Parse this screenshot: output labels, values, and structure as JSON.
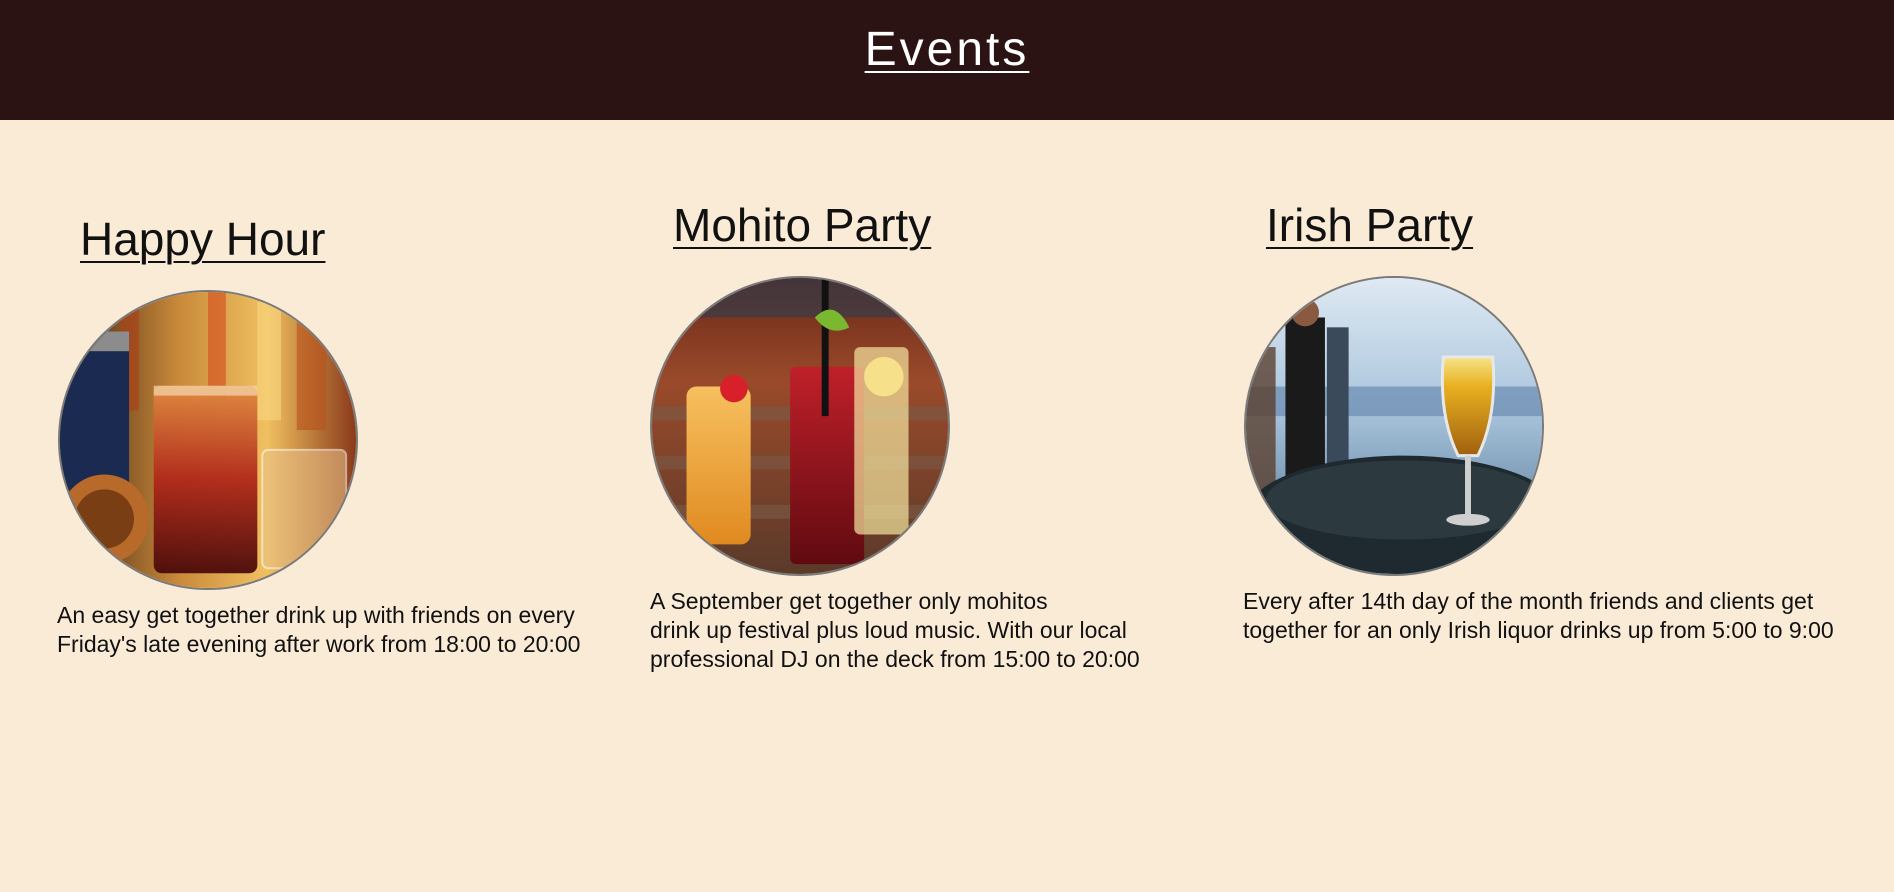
{
  "header": {
    "title": "Events"
  },
  "events": [
    {
      "title": "Happy Hour",
      "image_icon": "cocktail-bar-photo",
      "description": "An easy get together drink up with friends on every Friday's late evening after work from 18:00 to 20:00"
    },
    {
      "title": "Mohito Party",
      "image_icon": "mojito-drinks-photo",
      "description_lines": [
        "A September get together only mohitos",
        "drink up festival plus loud music. With our local professional DJ on the deck from 15:00 to 20:00"
      ]
    },
    {
      "title": "Irish Party",
      "image_icon": "beer-glass-photo",
      "description": "Every after 14th day of the month friends and clients get together for an only Irish liquor drinks up from 5:00 to 9:00"
    }
  ],
  "colors": {
    "header_bg": "#2b1213",
    "page_bg": "#faebd7"
  }
}
